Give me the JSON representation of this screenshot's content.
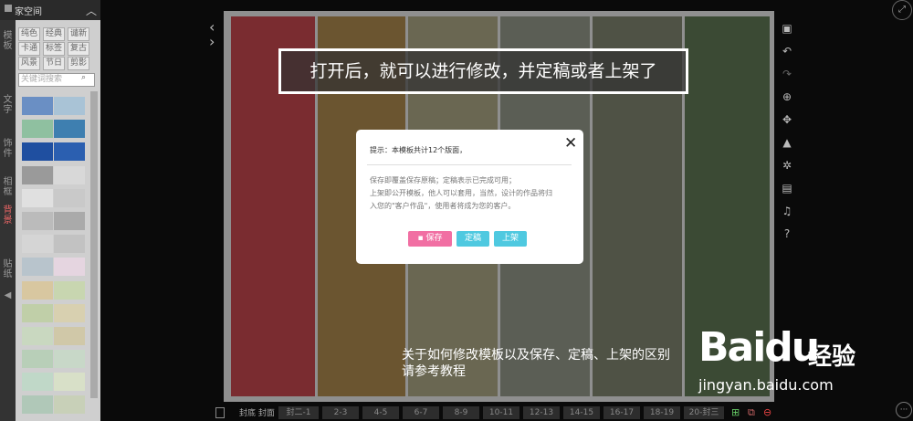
{
  "sidebar": {
    "title": "家空间",
    "vtabs": [
      "模板",
      "文字",
      "饰件",
      "相框",
      "背景",
      "贴纸"
    ],
    "active_tab": "背景",
    "tags": [
      "纯色",
      "经典",
      "谴新",
      "卡通",
      "标签",
      "复古",
      "风景",
      "节日",
      "剪影"
    ],
    "search_placeholder": "关键词搜索"
  },
  "annotation": "打开后，就可以进行修改，并定稿或者上架了",
  "modal": {
    "title": "提示：本模板共计12个版面，",
    "line1": "保存即覆盖保存原稿；定稿表示已完成可用；",
    "line2": "上架即公开模板，他人可以套用，当然，设计的作品将归",
    "line3": "入您的\"客户作品\"，使用者将成为您的客户。",
    "buttons": {
      "save": "保存",
      "finalize": "定稿",
      "publish": "上架"
    }
  },
  "stripes": [
    "#7a2c30",
    "#6b5530",
    "#6a6752",
    "#5b5e55",
    "#4f5245",
    "#3b4a34"
  ],
  "pagebar": {
    "label": "封底 封面",
    "pages": [
      "封二-1",
      "2-3",
      "4-5",
      "6-7",
      "8-9",
      "10-11",
      "12-13",
      "14-15",
      "16-17",
      "18-19",
      "20-封三"
    ]
  },
  "caption": {
    "line1": "关于如何修改模板以及保存、定稿、上架的区别",
    "line2": "请参考教程"
  },
  "watermark": {
    "brand": "Baidu",
    "jingyan": "经验",
    "url": "jingyan.baidu.com"
  },
  "colors": {
    "save_btn": "#f16fa3",
    "finalize_btn": "#4fc9e0",
    "publish_btn": "#4fc9e0"
  }
}
